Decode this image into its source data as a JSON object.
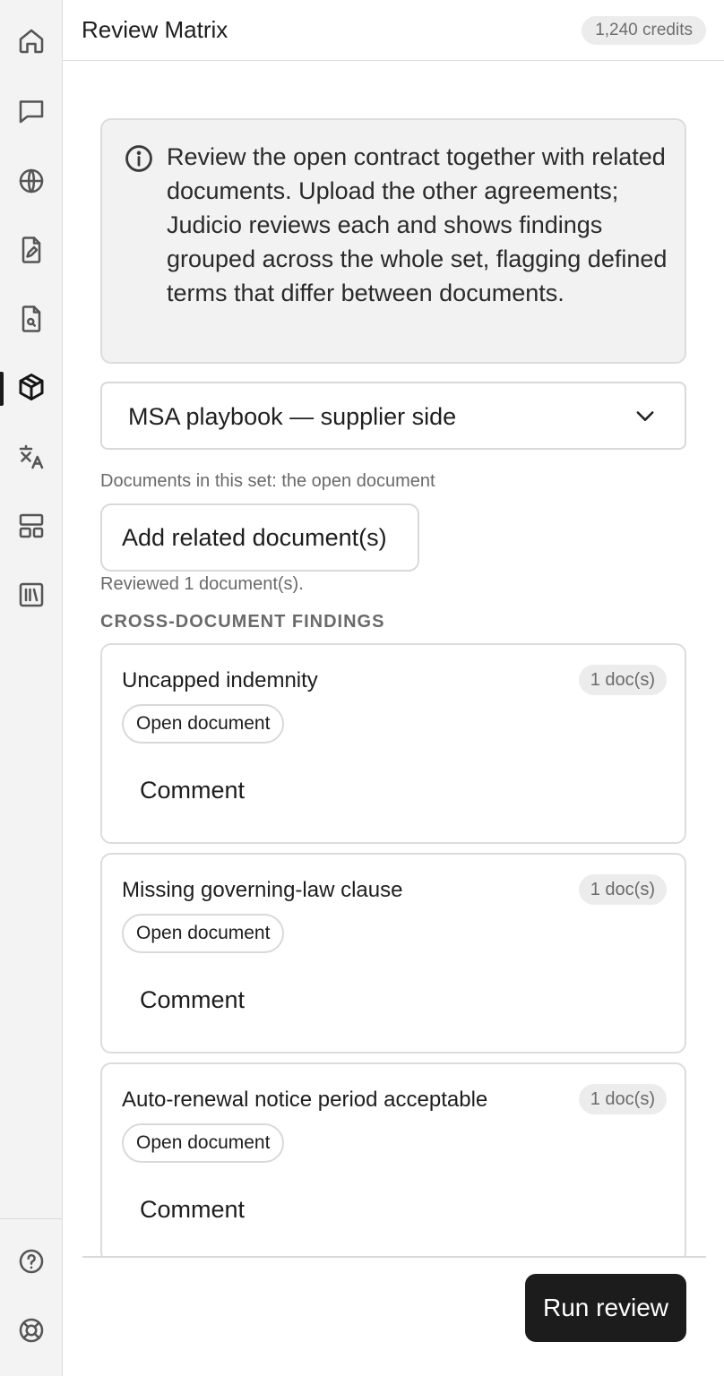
{
  "header": {
    "title": "Review Matrix",
    "credits": "1,240 credits"
  },
  "sidebar": {
    "items": [
      {
        "icon": "home-icon"
      },
      {
        "icon": "chat-icon"
      },
      {
        "icon": "globe-icon"
      },
      {
        "icon": "document-edit-icon"
      },
      {
        "icon": "document-search-icon"
      },
      {
        "icon": "cube-icon",
        "active": true
      },
      {
        "icon": "translate-icon"
      },
      {
        "icon": "layout-icon"
      },
      {
        "icon": "library-icon"
      }
    ],
    "bottom_items": [
      {
        "icon": "help-icon"
      },
      {
        "icon": "support-icon"
      }
    ]
  },
  "info": {
    "text": "Review the open contract together with related documents. Upload the other agreements; Judicio reviews each and shows findings grouped across the whole set, flagging defined terms that differ between documents."
  },
  "playbook": {
    "selected": "MSA playbook — supplier side"
  },
  "documents": {
    "caption": "Documents in this set: the open document",
    "add_button": "Add related document(s)",
    "reviewed_caption": "Reviewed 1 document(s)."
  },
  "findings": {
    "heading": "CROSS-DOCUMENT FINDINGS",
    "items": [
      {
        "title": "Uncapped indemnity",
        "count": "1 doc(s)",
        "chip": "Open document",
        "comment": "Comment"
      },
      {
        "title": "Missing governing-law clause",
        "count": "1 doc(s)",
        "chip": "Open document",
        "comment": "Comment"
      },
      {
        "title": "Auto-renewal notice period acceptable",
        "count": "1 doc(s)",
        "chip": "Open document",
        "comment": "Comment"
      }
    ]
  },
  "footer": {
    "run_button": "Run review"
  },
  "colors": {
    "accent": "#1c1c1c",
    "sidebar_bg": "#f3f3f3",
    "info_bg": "#f2f2f2"
  }
}
